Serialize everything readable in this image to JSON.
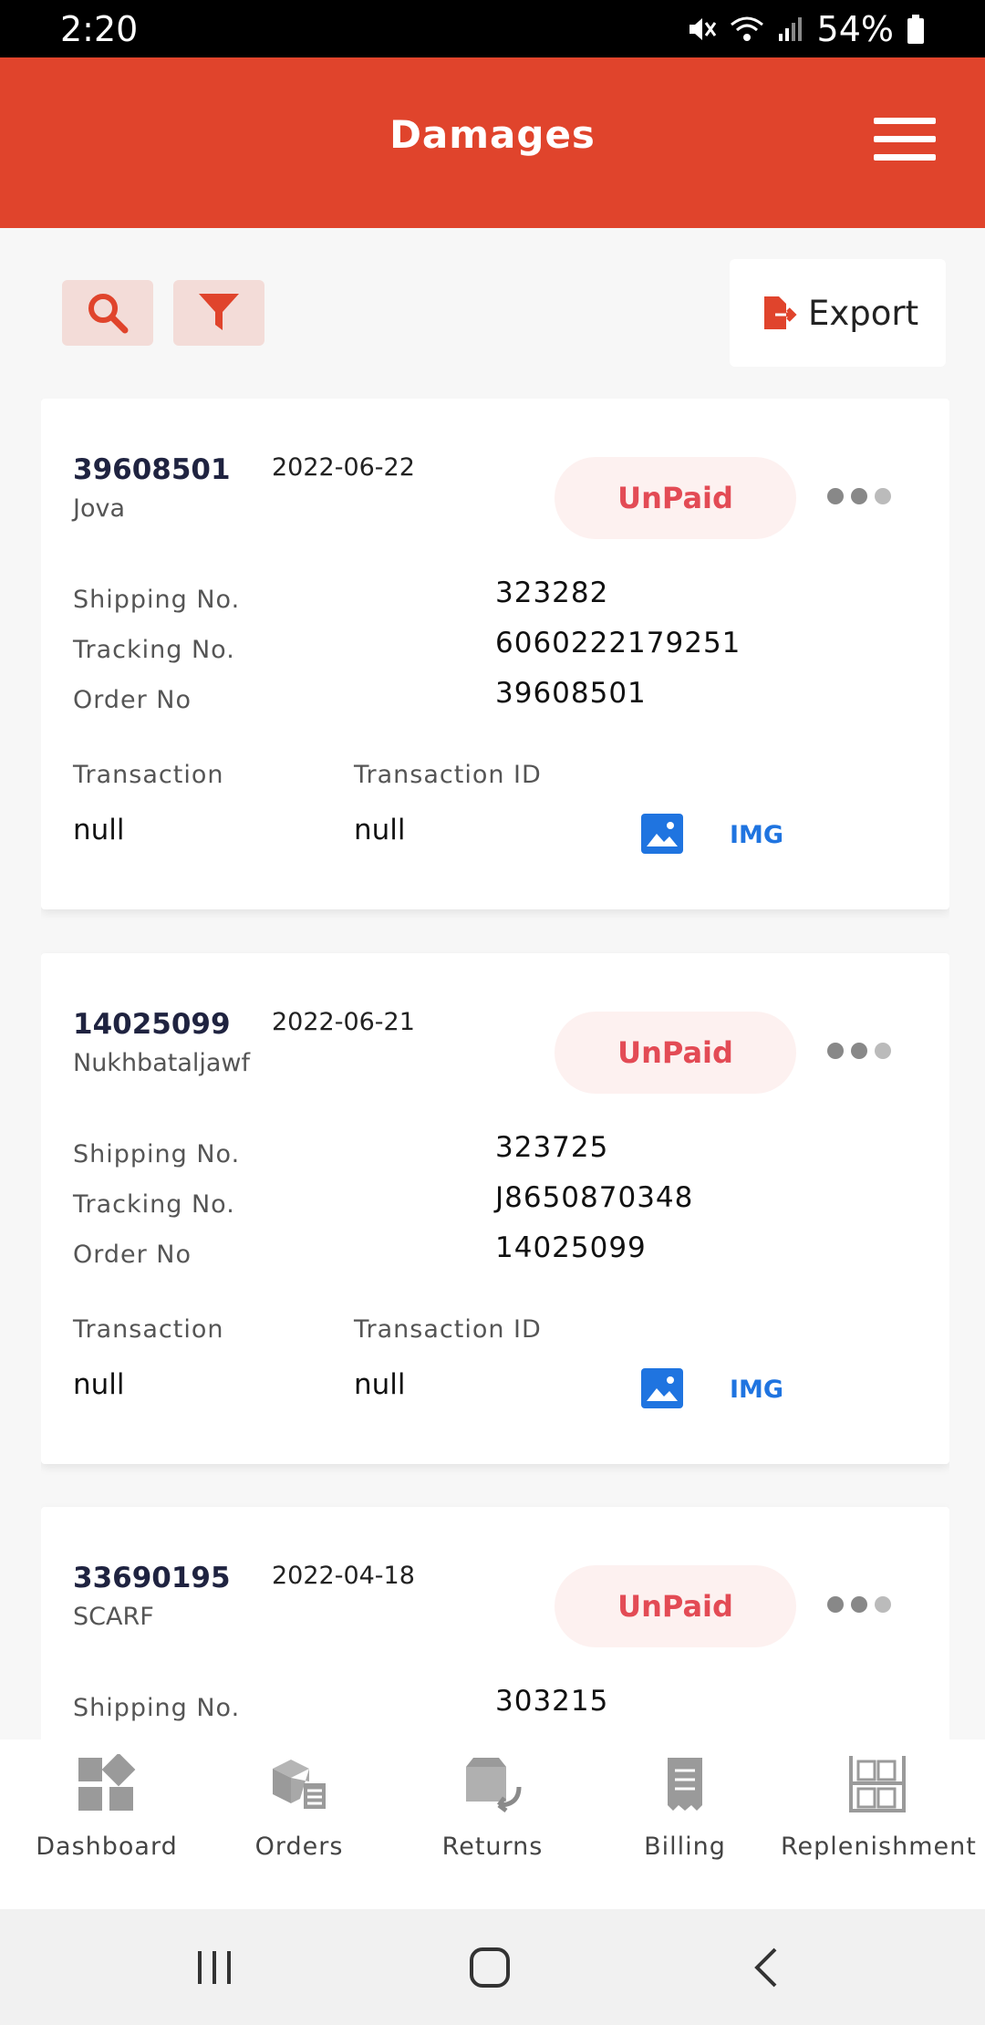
{
  "status_bar": {
    "time": "2:20",
    "battery": "54%"
  },
  "header": {
    "title": "Damages"
  },
  "toolbar": {
    "export_label": "Export"
  },
  "labels": {
    "shipping_no": "Shipping No.",
    "tracking_no": "Tracking No.",
    "order_no": "Order No",
    "transaction": "Transaction",
    "transaction_id": "Transaction ID",
    "img_link": "IMG"
  },
  "cards": [
    {
      "id": "39608501",
      "date": "2022-06-22",
      "customer": "Jova",
      "status": "UnPaid",
      "shipping_no": "323282",
      "tracking_no": "6060222179251",
      "order_no": "39608501",
      "transaction": "null",
      "transaction_id": "null"
    },
    {
      "id": "14025099",
      "date": "2022-06-21",
      "customer": "Nukhbataljawf",
      "status": "UnPaid",
      "shipping_no": "323725",
      "tracking_no": "J8650870348",
      "order_no": "14025099",
      "transaction": "null",
      "transaction_id": "null"
    },
    {
      "id": "33690195",
      "date": "2022-04-18",
      "customer": "SCARF",
      "status": "UnPaid",
      "shipping_no": "303215"
    }
  ],
  "bottom_nav": [
    {
      "label": "Dashboard",
      "icon": "dashboard-icon"
    },
    {
      "label": "Orders",
      "icon": "orders-icon"
    },
    {
      "label": "Returns",
      "icon": "returns-icon"
    },
    {
      "label": "Billing",
      "icon": "billing-icon"
    },
    {
      "label": "Replenishment",
      "icon": "replenishment-icon"
    }
  ],
  "colors": {
    "brand": "#e0442c",
    "status_unpaid": "#e34b55",
    "link": "#1f74e0"
  }
}
